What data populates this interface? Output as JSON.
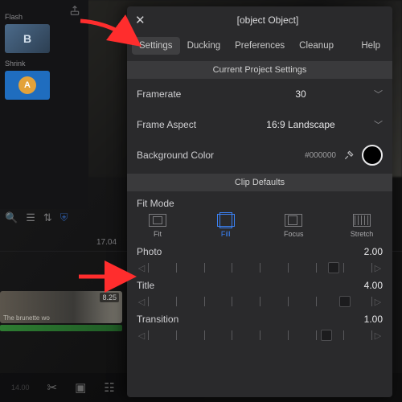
{
  "modal": {
    "title": {
      "label": "Title",
      "value": "4.00",
      "pos": 0.88
    },
    "tabs": {
      "settings": "Settings",
      "ducking": "Ducking",
      "preferences": "Preferences",
      "cleanup": "Cleanup",
      "help": "Help"
    },
    "sections": {
      "project": "Current Project Settings",
      "clip": "Clip Defaults"
    },
    "framerate": {
      "label": "Framerate",
      "value": "30"
    },
    "aspect": {
      "label": "Frame Aspect",
      "value": "16:9  Landscape"
    },
    "bgcolor": {
      "label": "Background Color",
      "hex": "#000000"
    },
    "fit": {
      "label": "Fit Mode",
      "fit": "Fit",
      "fill": "Fill",
      "focus": "Focus",
      "stretch": "Stretch"
    },
    "photo": {
      "label": "Photo",
      "value": "2.00",
      "pos": 0.83
    },
    "transition": {
      "label": "Transition",
      "value": "1.00",
      "pos": 0.8
    }
  },
  "left": {
    "flash": "Flash",
    "shrink": "Shrink",
    "b": "B",
    "a": "A"
  },
  "timeline": {
    "timecode_top": "17.04",
    "clip_dur": "8.25",
    "clip_caption": "The brunette wo",
    "timecode_bottom": "14.00"
  }
}
